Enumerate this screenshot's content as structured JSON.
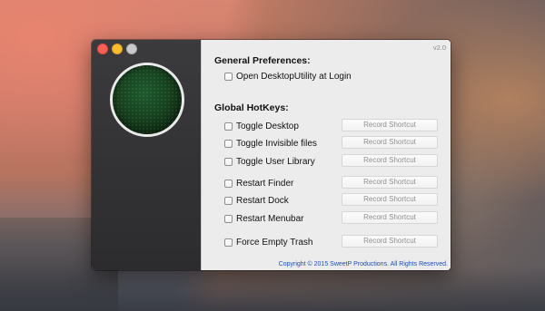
{
  "app": {
    "version": "v2.0"
  },
  "window_controls": {
    "close_icon": "close-icon",
    "minimize_icon": "minimize-icon",
    "maximize_icon": "maximize-icon"
  },
  "general": {
    "title": "General Preferences:",
    "open_at_login_label": "Open DesktopUtility at Login"
  },
  "hotkeys": {
    "title": "Global HotKeys:",
    "items": [
      {
        "label": "Toggle Desktop",
        "button": "Record Shortcut"
      },
      {
        "label": "Toggle Invisible files",
        "button": "Record Shortcut"
      },
      {
        "label": "Toggle User Library",
        "button": "Record Shortcut"
      },
      {
        "label": "Restart Finder",
        "button": "Record Shortcut"
      },
      {
        "label": "Restart Dock",
        "button": "Record Shortcut"
      },
      {
        "label": "Restart Menubar",
        "button": "Record Shortcut"
      },
      {
        "label": "Force Empty Trash",
        "button": "Record Shortcut"
      }
    ]
  },
  "footer": {
    "copyright": "Copyright © 2015 SweetP Productions. All Rights Reserved."
  },
  "colors": {
    "accent_link": "#1d4fb3",
    "sidebar": "#333335",
    "close": "#fc5f57",
    "minimize": "#fdbc2e"
  }
}
